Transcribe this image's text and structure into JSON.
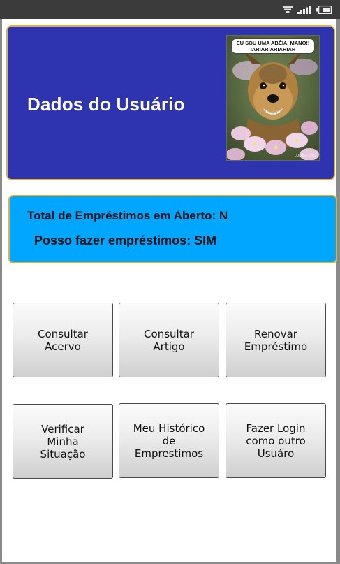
{
  "user_header": {
    "title": "Dados do Usuário",
    "avatar_caption_line1": "EU SOU UMA ABÊIA, MANO!!",
    "avatar_caption_line2": "IARIARIARIARIAR",
    "avatar_credit": "LOLdoG 2009"
  },
  "loan_info": {
    "total_open_loans": "Total de Empréstimos em Aberto: N",
    "can_borrow": "Posso fazer empréstimos: SIM"
  },
  "buttons": [
    {
      "label": "Consultar\nAcervo"
    },
    {
      "label": "Consultar\nArtigo"
    },
    {
      "label": "Renovar\nEmpréstimo"
    },
    {
      "label": "Verificar\nMinha\nSituação"
    },
    {
      "label": "Meu Histórico\nde\nEmprestimos"
    },
    {
      "label": "Fazer Login\ncomo outro\nUsuáro"
    }
  ],
  "colors": {
    "header_bg": "#2e33b0",
    "panel_bg": "#00a6ff",
    "border_accent": "#e0b03a"
  },
  "icons": [
    "wifi-icon",
    "signal-icon",
    "battery-icon"
  ]
}
